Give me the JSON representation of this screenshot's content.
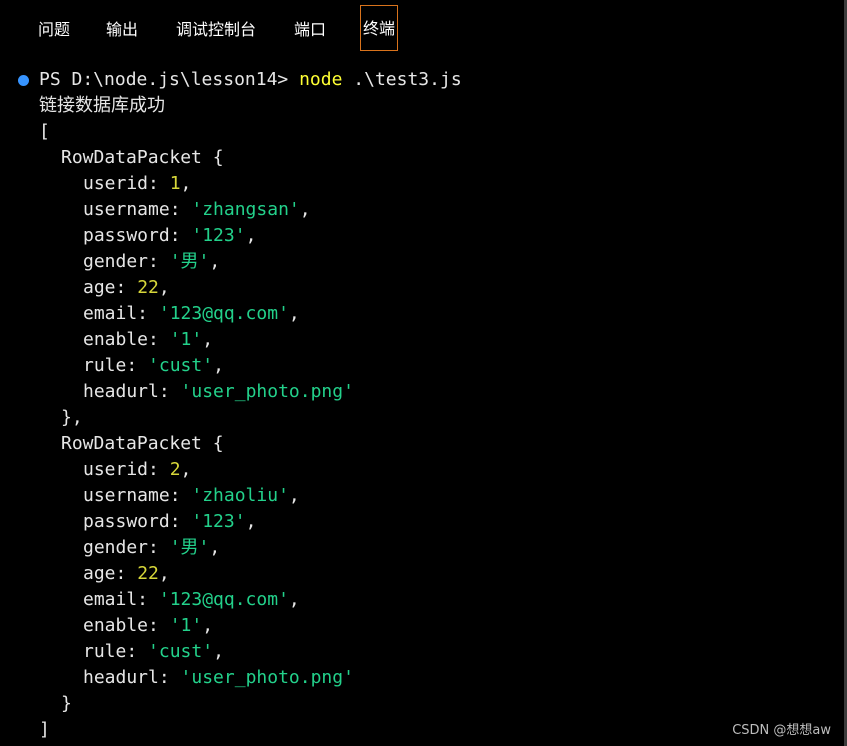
{
  "tabs": [
    {
      "label": "问题"
    },
    {
      "label": "输出"
    },
    {
      "label": "调试控制台"
    },
    {
      "label": "端口"
    },
    {
      "label": "终端",
      "active": true
    }
  ],
  "terminal": {
    "prompt": "PS D:\\node.js\\lesson14> ",
    "command": "node",
    "args": " .\\test3.js",
    "success_message": "链接数据库成功",
    "open_bracket": "[",
    "close_bracket": "]",
    "record_type": "RowDataPacket {",
    "record_close": "},",
    "last_record_close": "}",
    "records": [
      {
        "userid": "1",
        "username": "'zhangsan'",
        "password": "'123'",
        "gender": "'男'",
        "age": "22",
        "email": "'123@qq.com'",
        "enable": "'1'",
        "rule": "'cust'",
        "headurl": "'user_photo.png'"
      },
      {
        "userid": "2",
        "username": "'zhaoliu'",
        "password": "'123'",
        "gender": "'男'",
        "age": "22",
        "email": "'123@qq.com'",
        "enable": "'1'",
        "rule": "'cust'",
        "headurl": "'user_photo.png'"
      }
    ],
    "keys": {
      "userid": "userid: ",
      "username": "username: ",
      "password": "password: ",
      "gender": "gender: ",
      "age": "age: ",
      "email": "email: ",
      "enable": "enable: ",
      "rule": "rule: ",
      "headurl": "headurl: "
    },
    "comma": ","
  },
  "watermark": "CSDN @想想aw",
  "colors": {
    "background": "#000000",
    "text": "#e6e6e6",
    "command": "#ffff33",
    "number": "#d7d73a",
    "string": "#23d18b",
    "active_tab_border": "#d9731c",
    "status_dot": "#3794ff"
  }
}
